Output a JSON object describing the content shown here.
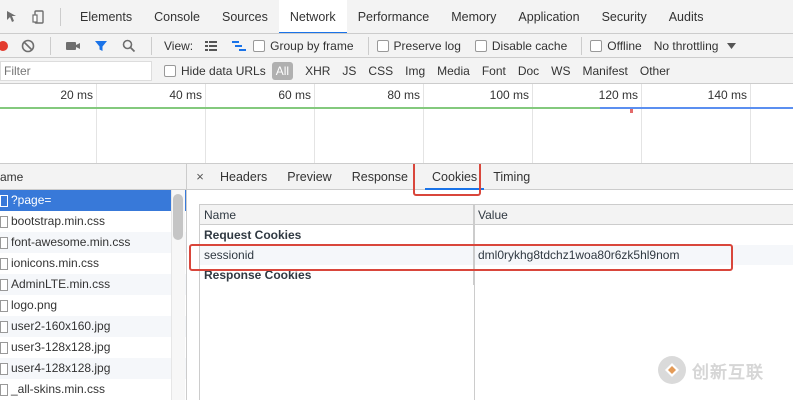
{
  "tabs": [
    "Elements",
    "Console",
    "Sources",
    "Network",
    "Performance",
    "Memory",
    "Application",
    "Security",
    "Audits"
  ],
  "active_tab": "Network",
  "toolbar": {
    "view_label": "View:",
    "group_by_frame": "Group by frame",
    "preserve_log": "Preserve log",
    "disable_cache": "Disable cache",
    "offline": "Offline",
    "throttling": "No throttling"
  },
  "filterbar": {
    "placeholder": "Filter",
    "hide_data_urls": "Hide data URLs",
    "all": "All",
    "types": [
      "XHR",
      "JS",
      "CSS",
      "Img",
      "Media",
      "Font",
      "Doc",
      "WS",
      "Manifest",
      "Other"
    ]
  },
  "timeline": {
    "ticks": [
      "20 ms",
      "40 ms",
      "60 ms",
      "80 ms",
      "100 ms",
      "120 ms",
      "140 ms"
    ]
  },
  "filelist": {
    "header": "ame",
    "files": [
      "?page=",
      "bootstrap.min.css",
      "font-awesome.min.css",
      "ionicons.min.css",
      "AdminLTE.min.css",
      "logo.png",
      "user2-160x160.jpg",
      "user3-128x128.jpg",
      "user4-128x128.jpg",
      "_all-skins.min.css"
    ]
  },
  "details": {
    "close": "×",
    "tabs": [
      "Headers",
      "Preview",
      "Response",
      "Cookies",
      "Timing"
    ],
    "active_tab": "Cookies",
    "cookies": {
      "col_name": "Name",
      "col_value": "Value",
      "request_section": "Request Cookies",
      "rows": [
        {
          "name": "sessionid",
          "value": "dml0rykhg8tdchz1woa80r6zk5hl9nom"
        }
      ],
      "response_section": "Response Cookies"
    }
  },
  "watermark": {
    "text": "创新互联"
  }
}
